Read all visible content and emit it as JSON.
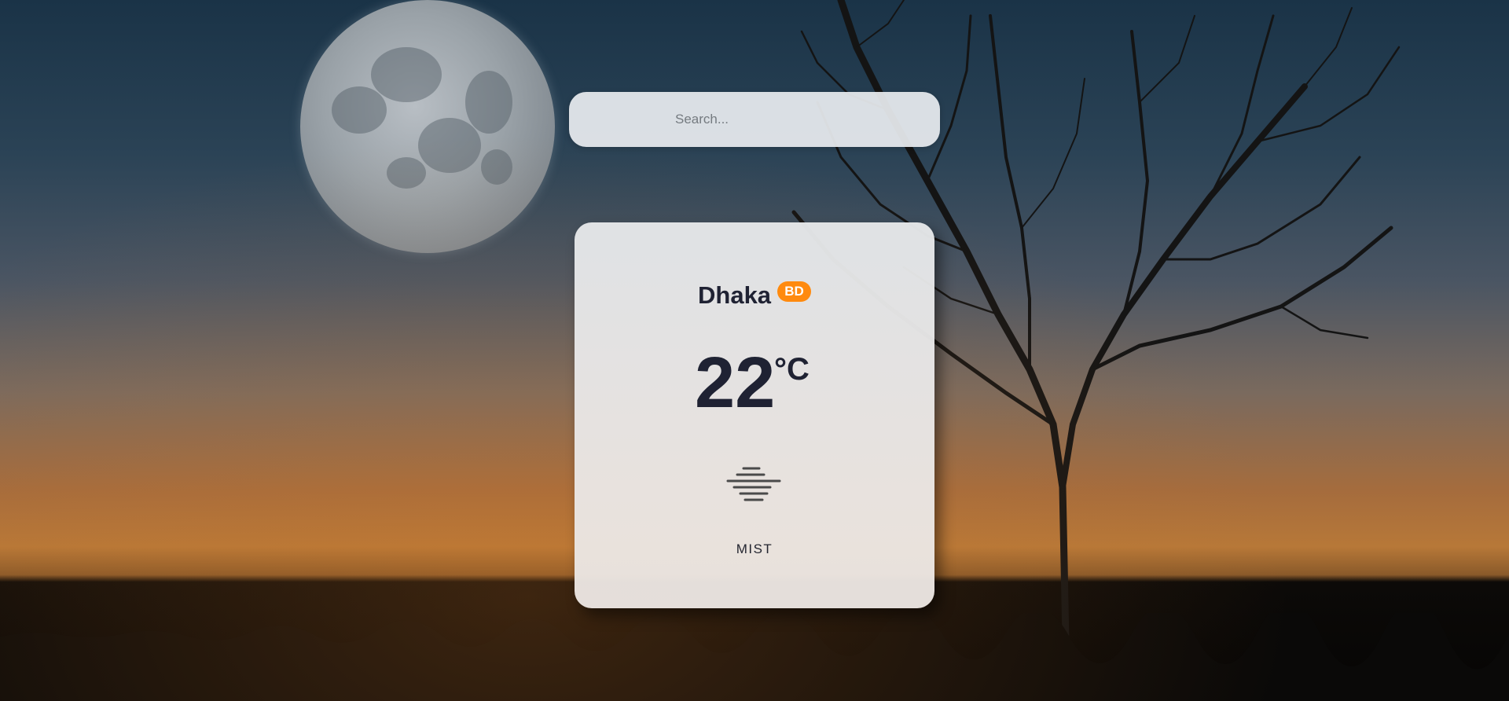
{
  "search": {
    "placeholder": "Search...",
    "value": ""
  },
  "weather": {
    "city": "Dhaka",
    "country_code": "BD",
    "temperature": "22",
    "unit": "°C",
    "condition": "MIST",
    "icon": "mist-icon"
  },
  "colors": {
    "badge": "#ff8a0e",
    "text_dark": "#1f2233"
  }
}
